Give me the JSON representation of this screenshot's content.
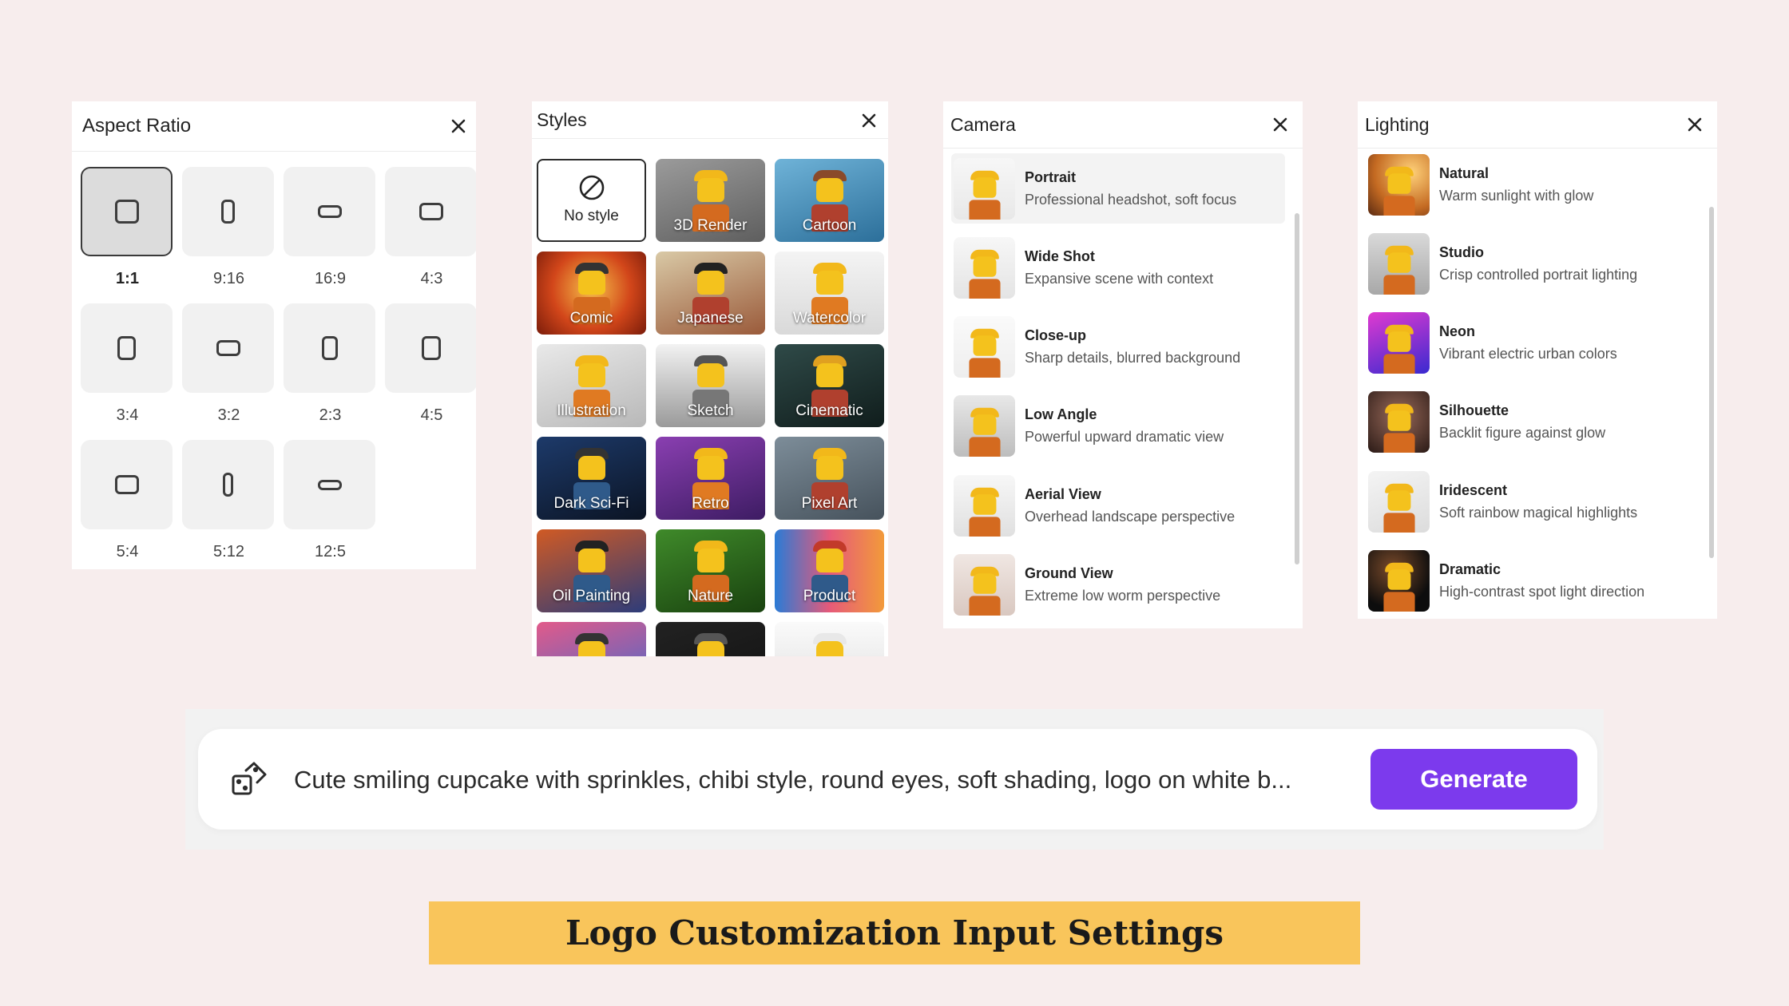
{
  "aspect_ratio": {
    "title": "Aspect Ratio",
    "selected": "1:1",
    "options": [
      {
        "label": "1:1"
      },
      {
        "label": "9:16"
      },
      {
        "label": "16:9"
      },
      {
        "label": "4:3"
      },
      {
        "label": "3:4"
      },
      {
        "label": "3:2"
      },
      {
        "label": "2:3"
      },
      {
        "label": "4:5"
      },
      {
        "label": "5:4"
      },
      {
        "label": "5:12"
      },
      {
        "label": "12:5"
      }
    ]
  },
  "styles": {
    "title": "Styles",
    "selected": "No style",
    "items": [
      {
        "label": "No style",
        "icon": "ban-icon"
      },
      {
        "label": "3D Render"
      },
      {
        "label": "Cartoon"
      },
      {
        "label": "Comic"
      },
      {
        "label": "Japanese"
      },
      {
        "label": "Watercolor"
      },
      {
        "label": "Illustration"
      },
      {
        "label": "Sketch"
      },
      {
        "label": "Cinematic"
      },
      {
        "label": "Dark Sci-Fi"
      },
      {
        "label": "Retro"
      },
      {
        "label": "Pixel Art"
      },
      {
        "label": "Oil Painting"
      },
      {
        "label": "Nature"
      },
      {
        "label": "Product"
      },
      {
        "label": ""
      },
      {
        "label": ""
      },
      {
        "label": ""
      }
    ]
  },
  "camera": {
    "title": "Camera",
    "selected": "Portrait",
    "items": [
      {
        "title": "Portrait",
        "desc": "Professional headshot, soft focus"
      },
      {
        "title": "Wide Shot",
        "desc": "Expansive scene with context"
      },
      {
        "title": "Close-up",
        "desc": "Sharp details, blurred background"
      },
      {
        "title": "Low Angle",
        "desc": "Powerful upward dramatic view"
      },
      {
        "title": "Aerial View",
        "desc": "Overhead landscape perspective"
      },
      {
        "title": "Ground View",
        "desc": "Extreme low worm perspective"
      }
    ]
  },
  "lighting": {
    "title": "Lighting",
    "items": [
      {
        "title": "Natural",
        "desc": "Warm sunlight with glow"
      },
      {
        "title": "Studio",
        "desc": "Crisp controlled portrait lighting"
      },
      {
        "title": "Neon",
        "desc": "Vibrant electric urban colors"
      },
      {
        "title": "Silhouette",
        "desc": "Backlit figure against glow"
      },
      {
        "title": "Iridescent",
        "desc": "Soft rainbow magical highlights"
      },
      {
        "title": "Dramatic",
        "desc": "High-contrast spot light direction"
      }
    ]
  },
  "prompt": {
    "text": "Cute smiling cupcake with sprinkles, chibi style, round eyes, soft shading, logo on white b...",
    "icon": "dice-icon",
    "button": "Generate"
  },
  "caption": "Logo Customization Input Settings",
  "colors": {
    "accent": "#7c3aed",
    "caption_bg": "#f9c55b",
    "page_bg": "#f7eded"
  }
}
